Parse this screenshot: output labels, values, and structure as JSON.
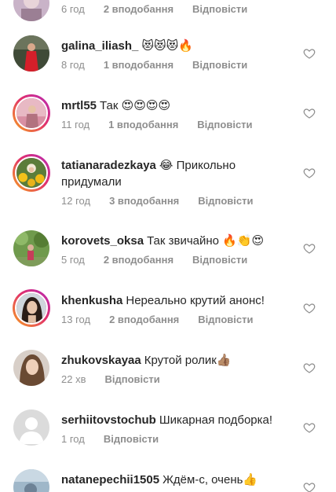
{
  "comments": [
    {
      "username": "",
      "text": "",
      "time": "6 год",
      "likes": "2 вподобання",
      "reply": "Відповісти",
      "avatar": "top-partial"
    },
    {
      "username": "galina_iliash_",
      "text": "😻😻😻🔥",
      "time": "8 год",
      "likes": "1 вподобання",
      "reply": "Відповісти",
      "avatar": "red-dress"
    },
    {
      "username": "mrtl55",
      "text": "Так 😍😍😍😍",
      "time": "11 год",
      "likes": "1 вподобання",
      "reply": "Відповісти",
      "avatar": "pink-room"
    },
    {
      "username": "tatianaradezkaya",
      "text": "😂 Прикольно придумали",
      "time": "12 год",
      "likes": "3 вподобання",
      "reply": "Відповісти",
      "avatar": "sunflowers"
    },
    {
      "username": "korovets_oksa",
      "text": "Так звичайно 🔥👏😍",
      "time": "5 год",
      "likes": "2 вподобання",
      "reply": "Відповісти",
      "avatar": "park"
    },
    {
      "username": "khenkusha",
      "text": "Нереально крутий анонс!",
      "time": "13 год",
      "likes": "2 вподобання",
      "reply": "Відповісти",
      "avatar": "dark-hair"
    },
    {
      "username": "zhukovskayaa",
      "text": "Крутой ролик👍🏽",
      "time": "22 хв",
      "likes": "",
      "reply": "Відповісти",
      "avatar": "brown-hair"
    },
    {
      "username": "serhiitovstochub",
      "text": "Шикарная подборка!",
      "time": "1 год",
      "likes": "",
      "reply": "Відповісти",
      "avatar": "default"
    },
    {
      "username": "natanepechii1505",
      "text": "Ждём-с, очень👍",
      "time": "",
      "likes": "",
      "reply": "",
      "avatar": "bottom-partial"
    }
  ]
}
